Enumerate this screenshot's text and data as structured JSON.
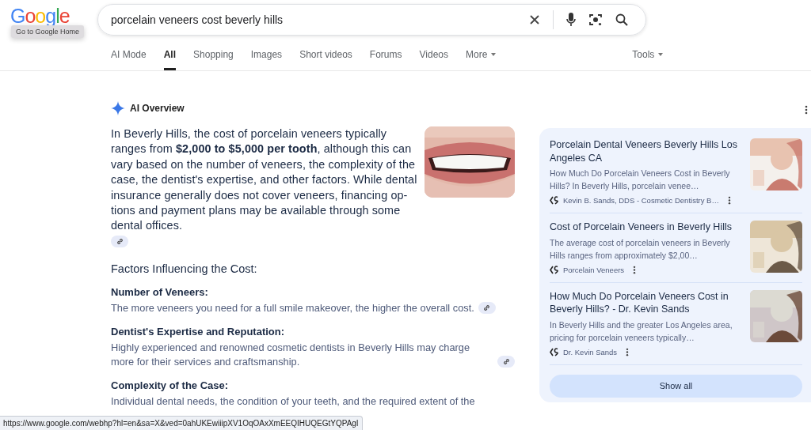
{
  "logo": {
    "text": "Google",
    "tooltip": "Go to Google Home"
  },
  "search": {
    "value": "porcelain veneers cost beverly hills"
  },
  "tabs": [
    {
      "label": "AI Mode",
      "selected": false,
      "kind": "tab"
    },
    {
      "label": "All",
      "selected": true,
      "kind": "tab"
    },
    {
      "label": "Shopping",
      "selected": false,
      "kind": "tab"
    },
    {
      "label": "Images",
      "selected": false,
      "kind": "tab"
    },
    {
      "label": "Short videos",
      "selected": false,
      "kind": "tab"
    },
    {
      "label": "Forums",
      "selected": false,
      "kind": "tab"
    },
    {
      "label": "Videos",
      "selected": false,
      "kind": "tab"
    },
    {
      "label": "More",
      "selected": false,
      "kind": "menu"
    }
  ],
  "tools": {
    "label": "Tools"
  },
  "ai_overview": {
    "title": "AI Overview",
    "summary": "In Beverly Hills, the cost of porcelain veneers typically ranges from **$2,000 to $5,000 per tooth**, although this can vary based on the number of veneers, the complexity of the case, the dentist's expertise, and other factors. While dental insurance generally does not cover veneers, financing op-tions and payment plans may be available through some dental offices.",
    "heading": "Factors Influencing the Cost:",
    "factors": [
      {
        "title": "Number of Veneers:",
        "text": "The more veneers you need for a full smile makeover, the higher the overall cost.",
        "link_chip": true
      },
      {
        "title": "Dentist's Expertise and Reputation:",
        "text": "Highly experienced and renowned cosmetic dentists in Beverly Hills may charge more for their services and craftsmanship.",
        "link_chip": true
      },
      {
        "title": "Complexity of the Case:",
        "text": "Individual dental needs, the condition of your teeth, and the required extent of the",
        "link_chip": false
      }
    ]
  },
  "sources": [
    {
      "title": "Porcelain Dental Veneers Beverly Hills Los Angeles CA",
      "snippet": "How Much Do Porcelain Veneers Cost in Beverly Hills? In Beverly Hills, porcelain venee…",
      "site": "Kevin B. Sands, DDS - Cosmetic Dentistry B…"
    },
    {
      "title": "Cost of Porcelain Veneers in Beverly Hills",
      "snippet": "The average cost of porcelain veneers in Beverly Hills ranges from approximately $2,00…",
      "site": "Porcelain Veneers"
    },
    {
      "title": "How Much Do Porcelain Veneers Cost in Beverly Hills? - Dr. Kevin Sands",
      "snippet": "In Beverly Hills and the greater Los Angeles area, pricing for porcelain veneers typically…",
      "site": "Dr. Kevin Sands"
    }
  ],
  "show_all": {
    "label": "Show all"
  },
  "status_bar": {
    "url": "https://www.google.com/webhp?hl=en&sa=X&ved=0ahUKEwiiipXV1OqOAxXmEEQIHUQEGtYQPAgI"
  }
}
